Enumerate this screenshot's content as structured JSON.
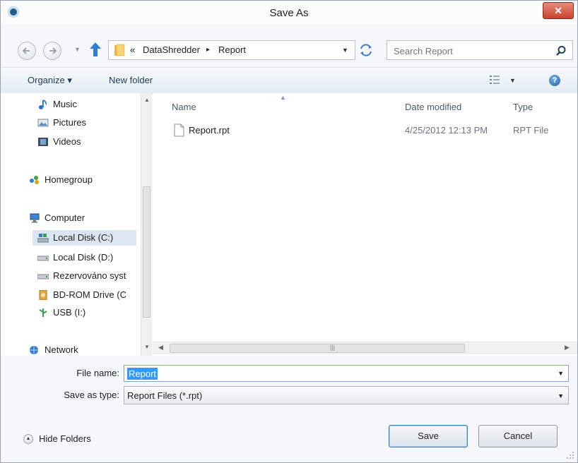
{
  "window": {
    "title": "Save As",
    "close_symbol": "✕"
  },
  "navigation": {
    "back_icon": "back-arrow-icon",
    "forward_icon": "forward-arrow-icon",
    "breadcrumb_prefix": "«",
    "breadcrumbs": [
      "DataShredder",
      "Report"
    ],
    "breadcrumb_separator": "▸",
    "search_placeholder": "Search Report"
  },
  "toolbar": {
    "organize_label": "Organize ▾",
    "new_folder_label": "New folder",
    "help_symbol": "?"
  },
  "sidebar": {
    "items": [
      {
        "label": "Music",
        "icon": "music-icon"
      },
      {
        "label": "Pictures",
        "icon": "pictures-icon"
      },
      {
        "label": "Videos",
        "icon": "videos-icon"
      },
      {
        "label": "Homegroup",
        "icon": "homegroup-icon"
      },
      {
        "label": "Computer",
        "icon": "computer-icon"
      },
      {
        "label": "Local Disk (C:)",
        "icon": "drive-c-icon",
        "selected": true
      },
      {
        "label": "Local Disk (D:)",
        "icon": "drive-icon"
      },
      {
        "label": "Rezervováno syst",
        "icon": "drive-icon"
      },
      {
        "label": "BD-ROM Drive (C",
        "icon": "bd-rom-icon"
      },
      {
        "label": "USB (I:)",
        "icon": "usb-icon"
      },
      {
        "label": "Network",
        "icon": "network-icon"
      }
    ]
  },
  "file_list": {
    "columns": [
      "Name",
      "Date modified",
      "Type"
    ],
    "rows": [
      {
        "name": "Report.rpt",
        "date_modified": "4/25/2012 12:13 PM",
        "type": "RPT File"
      }
    ]
  },
  "form": {
    "file_name_label": "File name:",
    "file_name_value": "Report",
    "save_as_type_label": "Save as type:",
    "save_as_type_value": "Report Files (*.rpt)"
  },
  "footer": {
    "hide_folders_label": "Hide Folders",
    "save_label": "Save",
    "cancel_label": "Cancel"
  },
  "colors": {
    "selection": "#3399ff",
    "close_button": "#c8442f",
    "toolbar": "#e4ecf4"
  }
}
